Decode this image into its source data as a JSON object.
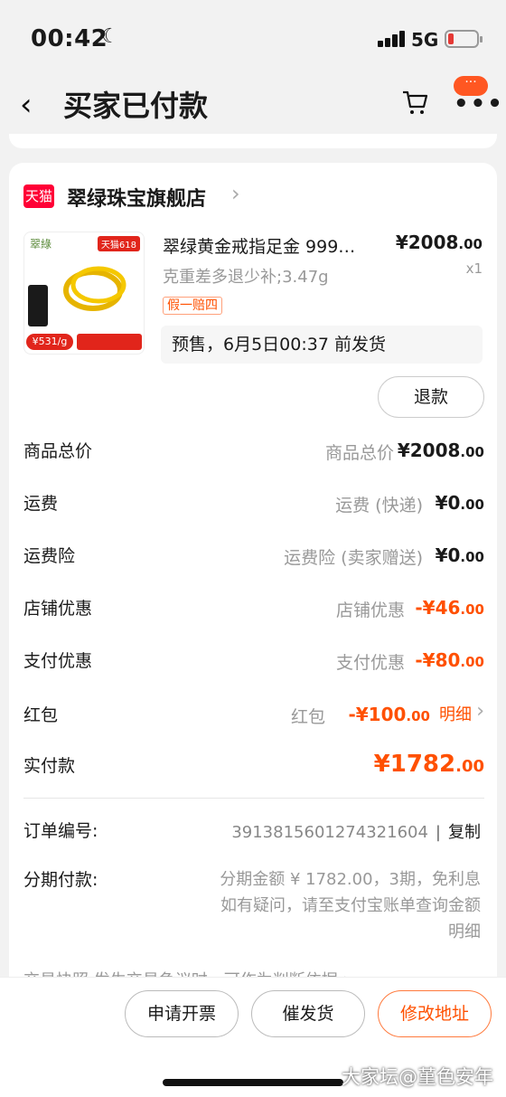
{
  "status_bar": {
    "time": "00:42",
    "network": "5G"
  },
  "nav": {
    "title": "买家已付款",
    "more_badge": "···"
  },
  "shop": {
    "platform_badge": "天猫",
    "name": "翠绿珠宝旗舰店"
  },
  "product": {
    "thumb_brand": "翠綠",
    "thumb_badge": "天猫618",
    "thumb_price": "¥531/g",
    "name": "翠绿黄金戒指足金 999…",
    "price_main": "¥2008",
    "price_decimal": ".00",
    "spec": "克重差多退少补;3.47g",
    "quantity": "x1",
    "tag": "假一赔四",
    "presale": "预售，6月5日00:37 前发货",
    "refund_button": "退款"
  },
  "fees": [
    {
      "label": "商品总价",
      "sub": "商品总价",
      "amount": "¥2008",
      "decimal": ".00",
      "orange": false
    },
    {
      "label": "运费",
      "sub": "运费 (快递)",
      "amount": "¥0",
      "decimal": ".00",
      "orange": false
    },
    {
      "label": "运费险",
      "sub": "运费险 (卖家赠送)",
      "amount": "¥0",
      "decimal": ".00",
      "orange": false
    },
    {
      "label": "店铺优惠",
      "sub": "店铺优惠",
      "amount": "-¥46",
      "decimal": ".00",
      "orange": true
    },
    {
      "label": "支付优惠",
      "sub": "支付优惠",
      "amount": "-¥80",
      "decimal": ".00",
      "orange": true
    }
  ],
  "red_packet": {
    "label": "红包",
    "sub": "红包",
    "amount": "-¥100",
    "decimal": ".00",
    "detail": "明细"
  },
  "total": {
    "label": "实付款",
    "amount": "¥1782",
    "decimal": ".00"
  },
  "order": {
    "label": "订单编号:",
    "number": "3913815601274321604",
    "separator": "|",
    "copy": "复制"
  },
  "installment": {
    "label": "分期付款:",
    "line1": "分期金额 ¥ 1782.00，3期，免利息",
    "line2": "如有疑问，请至支付宝账单查询金额",
    "line3": "明细"
  },
  "cutoff_text": "交易快照     发生交易争议时，可作为判断依据 >",
  "buttons": {
    "invoice": "申请开票",
    "urge": "催发货",
    "change_address": "修改地址"
  },
  "watermark": "大家坛@堇色安年",
  "colors": {
    "accent": "#ff5000",
    "tmall": "#ff0036"
  }
}
